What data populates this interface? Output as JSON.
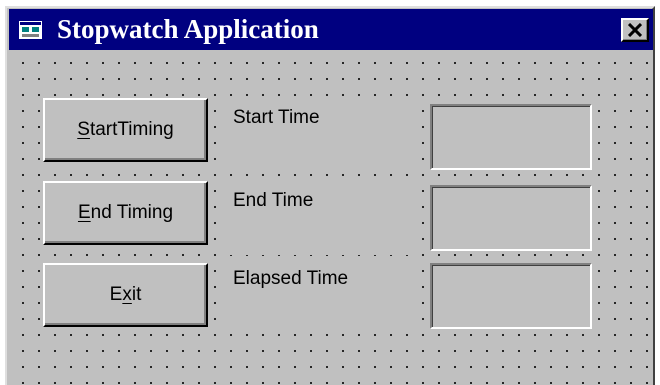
{
  "window": {
    "title": "Stopwatch Application",
    "app_icon": "form-icon",
    "close_icon": "close-x-icon"
  },
  "buttons": {
    "start": {
      "prefix": "",
      "accel": "S",
      "suffix": "tartTiming"
    },
    "end": {
      "prefix": "",
      "accel": "E",
      "suffix": "nd Timing"
    },
    "exit": {
      "prefix": "E",
      "accel": "x",
      "suffix": "it"
    }
  },
  "labels": {
    "start_time": "Start Time",
    "end_time": "End Time",
    "elapsed_time": "Elapsed Time"
  },
  "fields": {
    "start_time_value": "",
    "end_time_value": "",
    "elapsed_time_value": ""
  },
  "colors": {
    "titlebar": "#000080",
    "face": "#c0c0c0",
    "title_text": "#ffffff"
  }
}
